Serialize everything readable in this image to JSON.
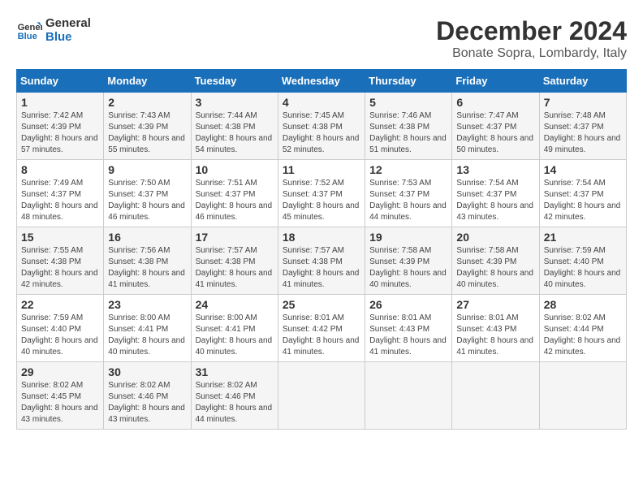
{
  "header": {
    "logo_line1": "General",
    "logo_line2": "Blue",
    "title": "December 2024",
    "subtitle": "Bonate Sopra, Lombardy, Italy"
  },
  "days_of_week": [
    "Sunday",
    "Monday",
    "Tuesday",
    "Wednesday",
    "Thursday",
    "Friday",
    "Saturday"
  ],
  "weeks": [
    [
      {
        "day": 1,
        "sunrise": "7:42 AM",
        "sunset": "4:39 PM",
        "daylight": "8 hours and 57 minutes."
      },
      {
        "day": 2,
        "sunrise": "7:43 AM",
        "sunset": "4:39 PM",
        "daylight": "8 hours and 55 minutes."
      },
      {
        "day": 3,
        "sunrise": "7:44 AM",
        "sunset": "4:38 PM",
        "daylight": "8 hours and 54 minutes."
      },
      {
        "day": 4,
        "sunrise": "7:45 AM",
        "sunset": "4:38 PM",
        "daylight": "8 hours and 52 minutes."
      },
      {
        "day": 5,
        "sunrise": "7:46 AM",
        "sunset": "4:38 PM",
        "daylight": "8 hours and 51 minutes."
      },
      {
        "day": 6,
        "sunrise": "7:47 AM",
        "sunset": "4:37 PM",
        "daylight": "8 hours and 50 minutes."
      },
      {
        "day": 7,
        "sunrise": "7:48 AM",
        "sunset": "4:37 PM",
        "daylight": "8 hours and 49 minutes."
      }
    ],
    [
      {
        "day": 8,
        "sunrise": "7:49 AM",
        "sunset": "4:37 PM",
        "daylight": "8 hours and 48 minutes."
      },
      {
        "day": 9,
        "sunrise": "7:50 AM",
        "sunset": "4:37 PM",
        "daylight": "8 hours and 46 minutes."
      },
      {
        "day": 10,
        "sunrise": "7:51 AM",
        "sunset": "4:37 PM",
        "daylight": "8 hours and 46 minutes."
      },
      {
        "day": 11,
        "sunrise": "7:52 AM",
        "sunset": "4:37 PM",
        "daylight": "8 hours and 45 minutes."
      },
      {
        "day": 12,
        "sunrise": "7:53 AM",
        "sunset": "4:37 PM",
        "daylight": "8 hours and 44 minutes."
      },
      {
        "day": 13,
        "sunrise": "7:54 AM",
        "sunset": "4:37 PM",
        "daylight": "8 hours and 43 minutes."
      },
      {
        "day": 14,
        "sunrise": "7:54 AM",
        "sunset": "4:37 PM",
        "daylight": "8 hours and 42 minutes."
      }
    ],
    [
      {
        "day": 15,
        "sunrise": "7:55 AM",
        "sunset": "4:38 PM",
        "daylight": "8 hours and 42 minutes."
      },
      {
        "day": 16,
        "sunrise": "7:56 AM",
        "sunset": "4:38 PM",
        "daylight": "8 hours and 41 minutes."
      },
      {
        "day": 17,
        "sunrise": "7:57 AM",
        "sunset": "4:38 PM",
        "daylight": "8 hours and 41 minutes."
      },
      {
        "day": 18,
        "sunrise": "7:57 AM",
        "sunset": "4:38 PM",
        "daylight": "8 hours and 41 minutes."
      },
      {
        "day": 19,
        "sunrise": "7:58 AM",
        "sunset": "4:39 PM",
        "daylight": "8 hours and 40 minutes."
      },
      {
        "day": 20,
        "sunrise": "7:58 AM",
        "sunset": "4:39 PM",
        "daylight": "8 hours and 40 minutes."
      },
      {
        "day": 21,
        "sunrise": "7:59 AM",
        "sunset": "4:40 PM",
        "daylight": "8 hours and 40 minutes."
      }
    ],
    [
      {
        "day": 22,
        "sunrise": "7:59 AM",
        "sunset": "4:40 PM",
        "daylight": "8 hours and 40 minutes."
      },
      {
        "day": 23,
        "sunrise": "8:00 AM",
        "sunset": "4:41 PM",
        "daylight": "8 hours and 40 minutes."
      },
      {
        "day": 24,
        "sunrise": "8:00 AM",
        "sunset": "4:41 PM",
        "daylight": "8 hours and 40 minutes."
      },
      {
        "day": 25,
        "sunrise": "8:01 AM",
        "sunset": "4:42 PM",
        "daylight": "8 hours and 41 minutes."
      },
      {
        "day": 26,
        "sunrise": "8:01 AM",
        "sunset": "4:43 PM",
        "daylight": "8 hours and 41 minutes."
      },
      {
        "day": 27,
        "sunrise": "8:01 AM",
        "sunset": "4:43 PM",
        "daylight": "8 hours and 41 minutes."
      },
      {
        "day": 28,
        "sunrise": "8:02 AM",
        "sunset": "4:44 PM",
        "daylight": "8 hours and 42 minutes."
      }
    ],
    [
      {
        "day": 29,
        "sunrise": "8:02 AM",
        "sunset": "4:45 PM",
        "daylight": "8 hours and 43 minutes."
      },
      {
        "day": 30,
        "sunrise": "8:02 AM",
        "sunset": "4:46 PM",
        "daylight": "8 hours and 43 minutes."
      },
      {
        "day": 31,
        "sunrise": "8:02 AM",
        "sunset": "4:46 PM",
        "daylight": "8 hours and 44 minutes."
      },
      null,
      null,
      null,
      null
    ]
  ],
  "labels": {
    "sunrise": "Sunrise:",
    "sunset": "Sunset:",
    "daylight": "Daylight:"
  }
}
